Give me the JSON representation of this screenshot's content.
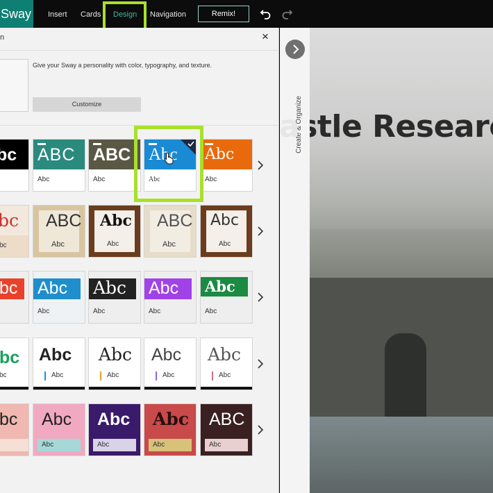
{
  "topbar": {
    "app_name": "Sway",
    "menu": {
      "insert": "Insert",
      "cards": "Cards",
      "design": "Design",
      "navigation": "Navigation"
    },
    "remix_label": "Remix!",
    "background": "#0c0c0c",
    "app_color": "#0f7f74"
  },
  "design_pane": {
    "title": "n",
    "close_label": "×",
    "personality_text": "Give your Sway a personality with color, typography, and texture.",
    "customize_label": "Customize"
  },
  "styles": {
    "heading_label": "Abc",
    "heading_caps": "ABC",
    "body_label": "Abc",
    "rows": [
      [
        "bc",
        "ABC",
        "ABC",
        "Abc",
        "Abc"
      ],
      [
        "bc",
        "ABC",
        "Abc",
        "ABC",
        "Abc"
      ],
      [
        "bc",
        "Abc",
        "Abc",
        "Abc",
        "Abc"
      ],
      [
        "bc",
        "Abc",
        "Abc",
        "Abc",
        "Abc"
      ],
      [
        "bc",
        "Abc",
        "Abc",
        "Abc",
        "ABC"
      ]
    ],
    "small_rows": [
      [
        "",
        "Abc",
        "Abc",
        "Abc",
        "Abc"
      ],
      [
        "bc",
        "Abc",
        "Abc",
        "Abc",
        "Abc"
      ],
      [
        "",
        "Abc",
        "Abc",
        "Abc",
        "Abc"
      ],
      [
        "bc",
        "Abc",
        "Abc",
        "Abc",
        "Abc"
      ],
      [
        "",
        "Abc",
        "Abc",
        "Abc",
        "Abc"
      ]
    ],
    "selected_row": 0,
    "selected_col": 3,
    "highlight_color": "#a8e02b"
  },
  "side_strip": {
    "label": "Create & Organize"
  },
  "preview": {
    "title": "astle Researc",
    "title_fragment": "a"
  }
}
